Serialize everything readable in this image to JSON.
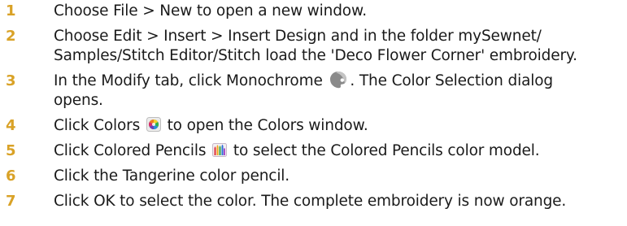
{
  "steps": [
    {
      "num": "1",
      "text": "Choose File > New to open a new window."
    },
    {
      "num": "2",
      "line1": "Choose Edit > Insert > Insert Design and in the folder mySewnet/",
      "line2": "Samples/Stitch Editor/Stitch load the 'Deco Flower Corner' embroidery."
    },
    {
      "num": "3",
      "before": "In the Modify tab, click Monochrome ",
      "icon": "monochrome-icon",
      "after": ". The Color Selection dialog",
      "line2": "opens."
    },
    {
      "num": "4",
      "before": "Click Colors ",
      "icon": "colors-icon",
      "after": " to open the Colors window."
    },
    {
      "num": "5",
      "before": "Click Colored Pencils ",
      "icon": "colored-pencils-icon",
      "after": " to select the Colored Pencils color model."
    },
    {
      "num": "6",
      "text": "Click the Tangerine color pencil."
    },
    {
      "num": "7",
      "text": "Click OK to select the color. The complete embroidery is now orange."
    }
  ],
  "colors": {
    "step_number": "#d9a227",
    "body_text": "#1a1a1a"
  }
}
